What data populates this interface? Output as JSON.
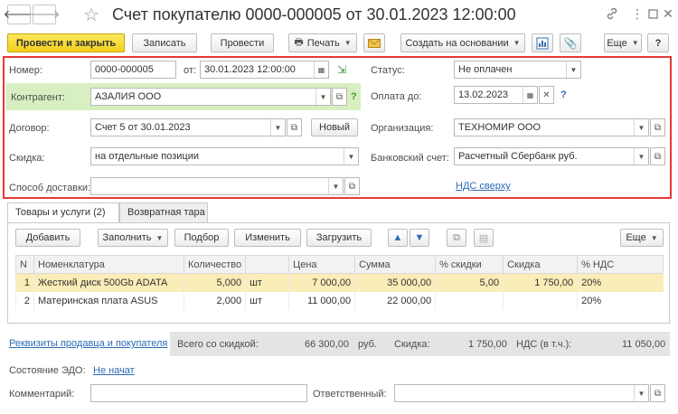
{
  "nav": {
    "back": "🡐",
    "forward": "🡒"
  },
  "window": {
    "title": "Счет покупателю 0000-000005 от 30.01.2023 12:00:00"
  },
  "toolbar": {
    "post_close": "Провести и закрыть",
    "save": "Записать",
    "post": "Провести",
    "print": "Печать",
    "create_based": "Создать на основании",
    "more": "Еще"
  },
  "form": {
    "number_label": "Номер:",
    "number": "0000-000005",
    "date_label": "от:",
    "date": "30.01.2023 12:00:00",
    "status_label": "Статус:",
    "status": "Не оплачен",
    "counterparty_label": "Контрагент:",
    "counterparty": "АЗАЛИЯ ООО",
    "pay_until_label": "Оплата до:",
    "pay_until": "13.02.2023",
    "contract_label": "Договор:",
    "contract": "Счет 5 от 30.01.2023",
    "new_btn": "Новый",
    "org_label": "Организация:",
    "org": "ТЕХНОМИР ООО",
    "discount_label": "Скидка:",
    "discount": "на отдельные позиции",
    "bank_label": "Банковский счет:",
    "bank": "Расчетный Сбербанк руб.",
    "delivery_label": "Способ доставки:",
    "delivery": "",
    "vat_link": "НДС сверху",
    "help": "?"
  },
  "tabs": [
    {
      "label": "Товары и услуги (2)"
    },
    {
      "label": "Возвратная тара"
    }
  ],
  "table_toolbar": {
    "add": "Добавить",
    "fill": "Заполнить",
    "pick": "Подбор",
    "change": "Изменить",
    "load": "Загрузить",
    "more": "Еще"
  },
  "table": {
    "headers": [
      "N",
      "Номенклатура",
      "Количество",
      "",
      "Цена",
      "Сумма",
      "% скидки",
      "Скидка",
      "% НДС"
    ],
    "rows": [
      {
        "n": "1",
        "name": "Жесткий диск 500Gb ADATA",
        "qty": "5,000",
        "unit": "шт",
        "price": "7 000,00",
        "sum": "35 000,00",
        "disc_pct": "5,00",
        "disc": "1 750,00",
        "vat": "20%"
      },
      {
        "n": "2",
        "name": "Материнская плата ASUS",
        "qty": "2,000",
        "unit": "шт",
        "price": "11 000,00",
        "sum": "22 000,00",
        "disc_pct": "",
        "disc": "",
        "vat": "20%"
      }
    ]
  },
  "footer": {
    "requisites_link": "Реквизиты продавца и покупателя",
    "total_label": "Всего со скидкой:",
    "total": "66 300,00",
    "currency": "руб.",
    "discount_label": "Скидка:",
    "discount": "1 750,00",
    "vat_label": "НДС (в т.ч.):",
    "vat": "11 050,00",
    "edo_label": "Состояние ЭДО:",
    "edo_value": "Не начат",
    "comment_label": "Комментарий:",
    "comment": "",
    "responsible_label": "Ответственный:",
    "responsible": ""
  },
  "colors": {
    "highlight": "#e53935",
    "primary_button": "#f3cf1c",
    "link": "#2a6bb5",
    "green_field": "#d7efc1"
  }
}
